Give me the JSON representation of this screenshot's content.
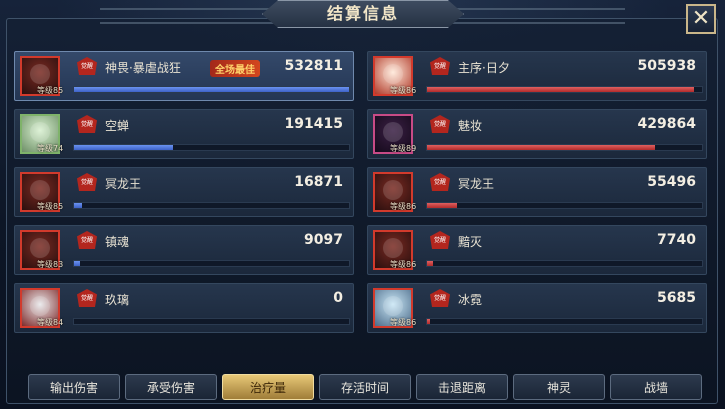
{
  "header": {
    "title": "结算信息",
    "close_label": "✕"
  },
  "left_rows": [
    {
      "badge": "觉醒",
      "name": "神畏·暴虐战狂",
      "value": "532811",
      "level": "等级85",
      "fill": 1.0,
      "mvp": "全场最佳",
      "avatar": "demon-warrior"
    },
    {
      "badge": "觉醒",
      "name": "空蝉",
      "value": "191415",
      "level": "等级74",
      "fill": 0.36,
      "avatar": "green-spirit"
    },
    {
      "badge": "觉醒",
      "name": "冥龙王",
      "value": "16871",
      "level": "等级85",
      "fill": 0.03,
      "avatar": "dragon-king"
    },
    {
      "badge": "觉醒",
      "name": "镇魂",
      "value": "9097",
      "level": "等级83",
      "fill": 0.02,
      "avatar": "armored-beast"
    },
    {
      "badge": "觉醒",
      "name": "玖璃",
      "value": "0",
      "level": "等级84",
      "fill": 0.0,
      "avatar": "white-hair-girl"
    }
  ],
  "right_rows": [
    {
      "badge": "觉醒",
      "name": "主序·日夕",
      "value": "505938",
      "level": "等级86",
      "fill": 0.97,
      "avatar": "masked-figure"
    },
    {
      "badge": "觉醒",
      "name": "魅妆",
      "value": "429864",
      "level": "等级89",
      "fill": 0.83,
      "avatar": "purple-dancer"
    },
    {
      "badge": "觉醒",
      "name": "冥龙王",
      "value": "55496",
      "level": "等级86",
      "fill": 0.11,
      "avatar": "dragon-king"
    },
    {
      "badge": "觉醒",
      "name": "黯灭",
      "value": "7740",
      "level": "等级86",
      "fill": 0.02,
      "avatar": "red-beast"
    },
    {
      "badge": "觉醒",
      "name": "冰霓",
      "value": "5685",
      "level": "等级86",
      "fill": 0.01,
      "avatar": "ice-warrior"
    }
  ],
  "tabs": [
    {
      "label": "输出伤害",
      "active": false
    },
    {
      "label": "承受伤害",
      "active": false
    },
    {
      "label": "治疗量",
      "active": true
    },
    {
      "label": "存活时间",
      "active": false
    },
    {
      "label": "击退距离",
      "active": false
    },
    {
      "label": "神灵",
      "active": false
    },
    {
      "label": "战墙",
      "active": false
    }
  ],
  "colors": {
    "left_bar": "#4a6fd8",
    "right_bar": "#c23a3a",
    "accent": "#d9b86a",
    "badge": "#b3261e"
  }
}
